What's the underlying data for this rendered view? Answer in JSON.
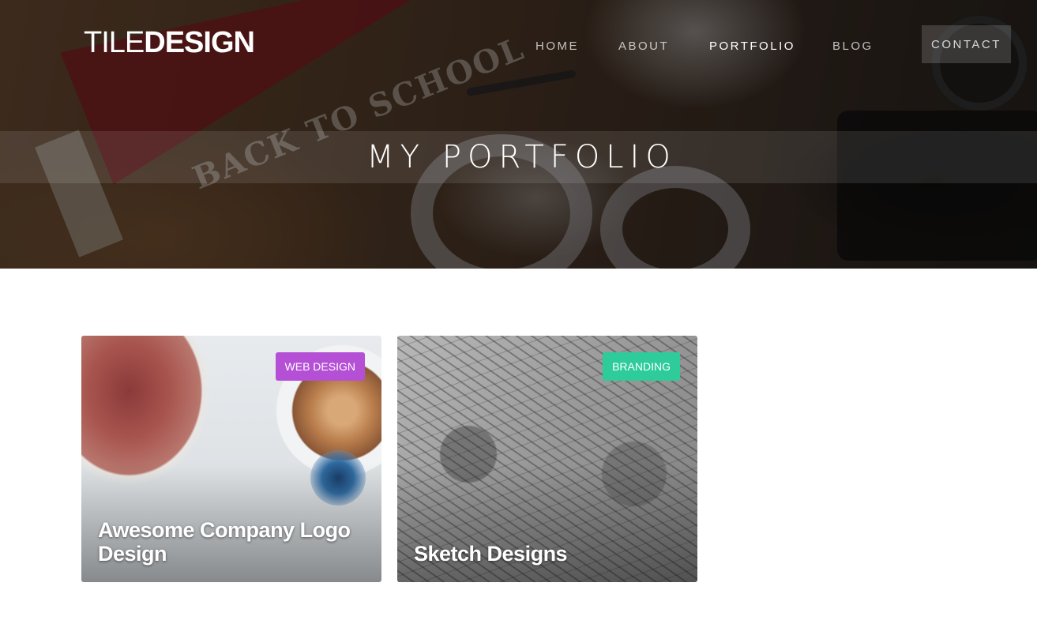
{
  "brand": {
    "logo_light": "TILE",
    "logo_bold": "DESIGN"
  },
  "nav": {
    "items": [
      {
        "label": "HOME",
        "active": false
      },
      {
        "label": "ABOUT",
        "active": false
      },
      {
        "label": "PORTFOLIO",
        "active": true
      },
      {
        "label": "BLOG",
        "active": false
      }
    ],
    "contact_label": "CONTACT"
  },
  "hero": {
    "title": "MY PORTFOLIO"
  },
  "portfolio": {
    "cards": [
      {
        "badge": "WEB DESIGN",
        "badge_color": "#b44fd6",
        "title": "Awesome Company Logo Design"
      },
      {
        "badge": "BRANDING",
        "badge_color": "#2ecc9a",
        "title": "Sketch Designs"
      }
    ]
  }
}
